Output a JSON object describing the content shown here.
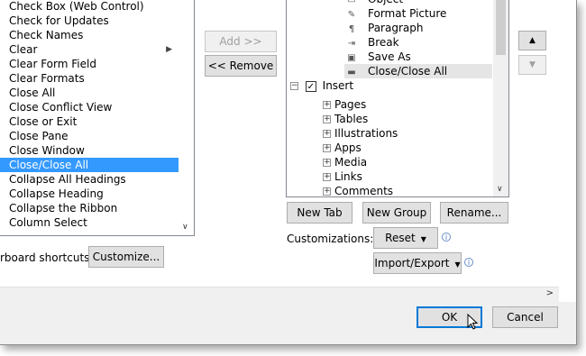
{
  "commands": [
    {
      "label": "Check Box (Web Control)",
      "submenu": false,
      "selected": false
    },
    {
      "label": "Check for Updates",
      "submenu": false,
      "selected": false
    },
    {
      "label": "Check Names",
      "submenu": false,
      "selected": false
    },
    {
      "label": "Clear",
      "submenu": true,
      "selected": false
    },
    {
      "label": "Clear Form Field",
      "submenu": false,
      "selected": false
    },
    {
      "label": "Clear Formats",
      "submenu": false,
      "selected": false
    },
    {
      "label": "Close All",
      "submenu": false,
      "selected": false
    },
    {
      "label": "Close Conflict View",
      "submenu": false,
      "selected": false
    },
    {
      "label": "Close or Exit",
      "submenu": false,
      "selected": false
    },
    {
      "label": "Close Pane",
      "submenu": false,
      "selected": false
    },
    {
      "label": "Close Window",
      "submenu": false,
      "selected": false
    },
    {
      "label": "Close/Close All",
      "submenu": false,
      "selected": true
    },
    {
      "label": "Collapse All Headings",
      "submenu": false,
      "selected": false
    },
    {
      "label": "Collapse Heading",
      "submenu": false,
      "selected": false
    },
    {
      "label": "Collapse the Ribbon",
      "submenu": false,
      "selected": false
    },
    {
      "label": "Column Select",
      "submenu": false,
      "selected": false
    }
  ],
  "buttons": {
    "add": "Add >>",
    "remove": "<< Remove",
    "customize": "Customize...",
    "new_tab": "New Tab",
    "new_group": "New Group",
    "rename": "Rename...",
    "reset": "Reset",
    "import_export": "Import/Export",
    "ok": "OK",
    "cancel": "Cancel"
  },
  "labels": {
    "keyboard_shortcuts": "rboard shortcuts:",
    "customizations": "Customizations:"
  },
  "tree_top": [
    {
      "label": "Object",
      "icon": "object-icon"
    },
    {
      "label": "Format Picture",
      "icon": "format-picture-icon"
    },
    {
      "label": "Paragraph",
      "icon": "paragraph-icon"
    },
    {
      "label": "Break",
      "icon": "break-icon"
    },
    {
      "label": "Save As",
      "icon": "save-as-icon"
    },
    {
      "label": "Close/Close All",
      "icon": "close-all-icon",
      "selected": true
    }
  ],
  "tree_insert": {
    "label": "Insert",
    "checked": true
  },
  "tree_groups": [
    "Pages",
    "Tables",
    "Illustrations",
    "Apps",
    "Media",
    "Links",
    "Comments"
  ],
  "colors": {
    "selection": "#3399ff",
    "tree_selection": "#e5e5e5",
    "default_button_border": "#0078d7"
  }
}
